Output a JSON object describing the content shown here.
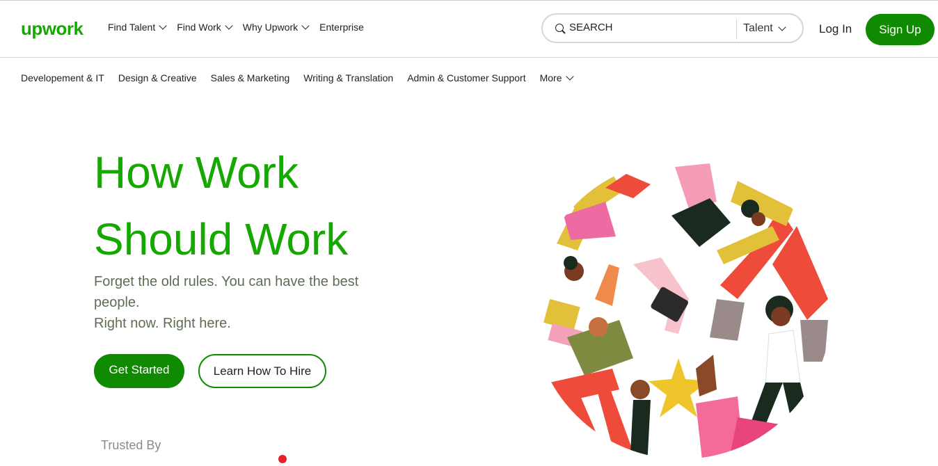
{
  "header": {
    "logo": "upwork",
    "nav": [
      {
        "label": "Find Talent",
        "dropdown": true
      },
      {
        "label": "Find Work",
        "dropdown": true
      },
      {
        "label": "Why Upwork",
        "dropdown": true
      },
      {
        "label": "Enterprise",
        "dropdown": false
      }
    ],
    "search": {
      "placeholder": "SEARCH",
      "value": "",
      "scope": "Talent"
    },
    "login_label": "Log In",
    "signup_label": "Sign Up"
  },
  "categories": [
    "Developement & IT",
    "Design & Creative",
    "Sales & Marketing",
    "Writing & Translation",
    "Admin & Customer Support",
    "More"
  ],
  "hero": {
    "title_line1": "How Work",
    "title_line2": "Should Work",
    "subtitle_line1": "Forget the old rules. You can have the best people.",
    "subtitle_line2": "Right now. Right here.",
    "cta_primary": "Get Started",
    "cta_secondary": "Learn How To Hire"
  },
  "trusted_label": "Trusted By",
  "colors": {
    "brand_green": "#14a800",
    "button_green": "#108a00"
  }
}
